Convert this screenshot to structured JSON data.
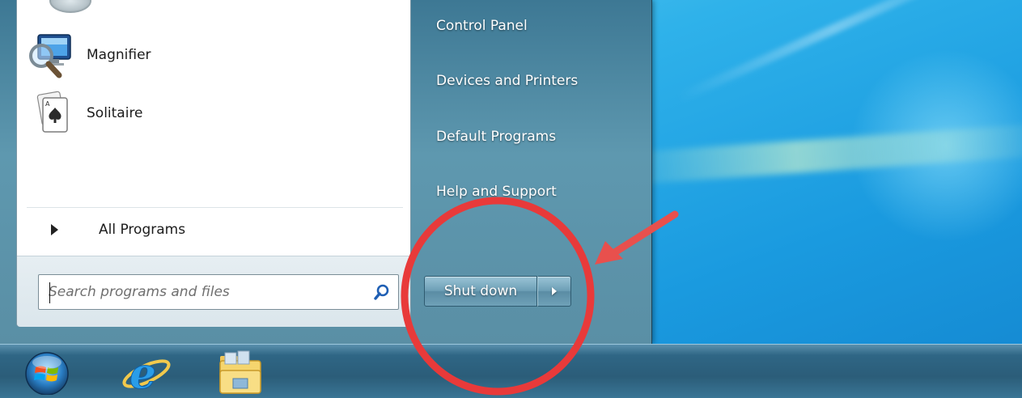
{
  "start_menu": {
    "programs": [
      {
        "label": "Magnifier",
        "icon": "magnifier-icon"
      },
      {
        "label": "Solitaire",
        "icon": "solitaire-icon"
      }
    ],
    "all_programs_label": "All Programs",
    "search": {
      "placeholder": "Search programs and files",
      "icon": "search-icon"
    },
    "right_items": [
      {
        "label": "Control Panel"
      },
      {
        "label": "Devices and Printers"
      },
      {
        "label": "Default Programs"
      },
      {
        "label": "Help and Support"
      }
    ],
    "shutdown": {
      "label": "Shut down",
      "arrow_icon": "chevron-right-icon"
    }
  },
  "taskbar": {
    "items": [
      {
        "icon": "windows-orb-icon"
      },
      {
        "icon": "internet-explorer-icon"
      },
      {
        "icon": "file-explorer-icon"
      }
    ]
  },
  "annotation": {
    "color": "#e83a3a",
    "shapes": [
      "circle-highlight",
      "arrow-pointer"
    ]
  }
}
